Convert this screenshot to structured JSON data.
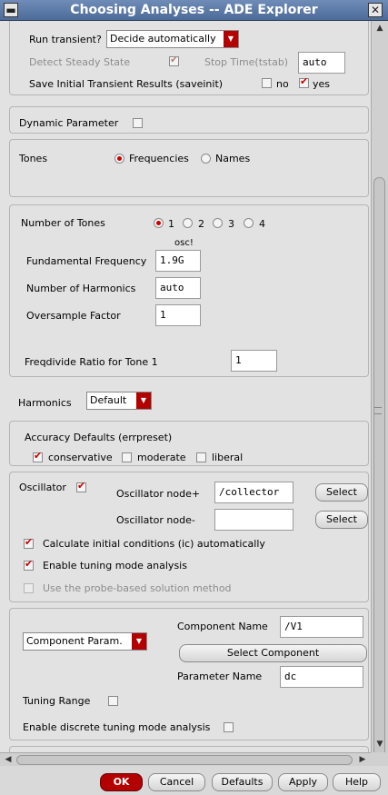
{
  "window": {
    "title": "Choosing Analyses -- ADE Explorer"
  },
  "transient": {
    "run_label": "Run transient?",
    "run_value": "Decide automatically",
    "steady_label": "Detect Steady State",
    "stop_label": "Stop Time(tstab)",
    "stop_value": "auto",
    "saveinit_label": "Save Initial Transient Results (saveinit)",
    "no_label": "no",
    "yes_label": "yes"
  },
  "dynamic": {
    "label": "Dynamic Parameter"
  },
  "tones": {
    "label": "Tones",
    "freq_label": "Frequencies",
    "names_label": "Names"
  },
  "numtones": {
    "label": "Number of Tones",
    "options": [
      "1",
      "2",
      "3",
      "4"
    ],
    "osc_header": "osc!",
    "fund_label": "Fundamental Frequency",
    "fund_value": "1.9G",
    "harm_label": "Number of Harmonics",
    "harm_value": "auto",
    "oversample_label": "Oversample Factor",
    "oversample_value": "1",
    "freqdiv_label": "Freqdivide Ratio for Tone 1",
    "freqdiv_value": "1"
  },
  "harmonics": {
    "label": "Harmonics",
    "value": "Default"
  },
  "accuracy": {
    "label": "Accuracy Defaults (errpreset)",
    "conservative": "conservative",
    "moderate": "moderate",
    "liberal": "liberal"
  },
  "oscillator": {
    "label": "Oscillator",
    "node_plus_label": "Oscillator node+",
    "node_plus_value": "/collector",
    "node_minus_label": "Oscillator node-",
    "node_minus_value": "",
    "select_label": "Select",
    "ic_label": "Calculate initial conditions (ic) automatically",
    "tuning_label": "Enable tuning mode analysis",
    "probe_label": "Use the probe-based solution method"
  },
  "component": {
    "type_value": "Component Param.",
    "name_label": "Component Name",
    "name_value": "/V1",
    "select_label": "Select Component",
    "param_label": "Parameter Name",
    "param_value": "dc",
    "tuning_range_label": "Tuning Range",
    "discrete_label": "Enable discrete tuning mode analysis"
  },
  "buttons": {
    "ok": "OK",
    "cancel": "Cancel",
    "defaults": "Defaults",
    "apply": "Apply",
    "help": "Help"
  },
  "colors": {
    "accent": "#cc0000",
    "titlebar": "#5b78a6"
  }
}
